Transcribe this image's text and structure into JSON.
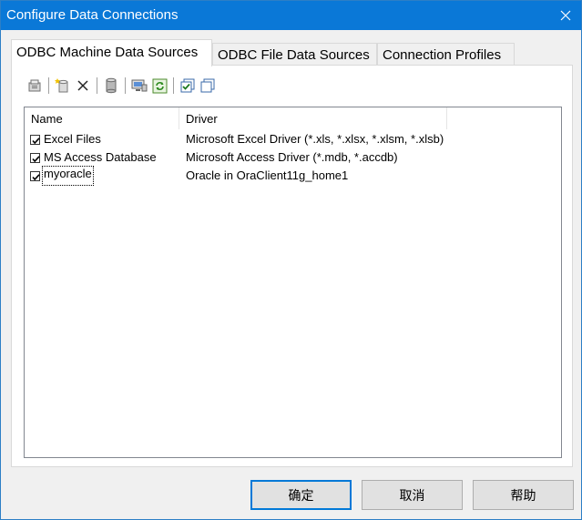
{
  "window": {
    "title": "Configure Data Connections"
  },
  "tabs": [
    {
      "label": "ODBC Machine Data Sources",
      "active": true
    },
    {
      "label": "ODBC File Data Sources",
      "active": false
    },
    {
      "label": "Connection Profiles",
      "active": false
    }
  ],
  "toolbar": {
    "buttons": [
      "properties-icon",
      "new-data-source-icon",
      "delete-icon",
      "database-icon",
      "configure-icon",
      "refresh-icon",
      "check-all-icon",
      "uncheck-all-icon"
    ]
  },
  "list": {
    "columns": [
      "Name",
      "Driver"
    ],
    "rows": [
      {
        "name": "Excel Files",
        "driver": "Microsoft Excel Driver (*.xls, *.xlsx, *.xlsm, *.xlsb)",
        "checked": true
      },
      {
        "name": "MS Access Database",
        "driver": "Microsoft Access Driver (*.mdb, *.accdb)",
        "checked": true
      },
      {
        "name": "myoracle",
        "driver": "Oracle in OraClient11g_home1",
        "checked": true
      }
    ]
  },
  "buttons": {
    "ok": "确定",
    "cancel": "取消",
    "help": "帮助"
  },
  "colors": {
    "titlebar": "#0a78d7",
    "accent": "#0078d7"
  }
}
